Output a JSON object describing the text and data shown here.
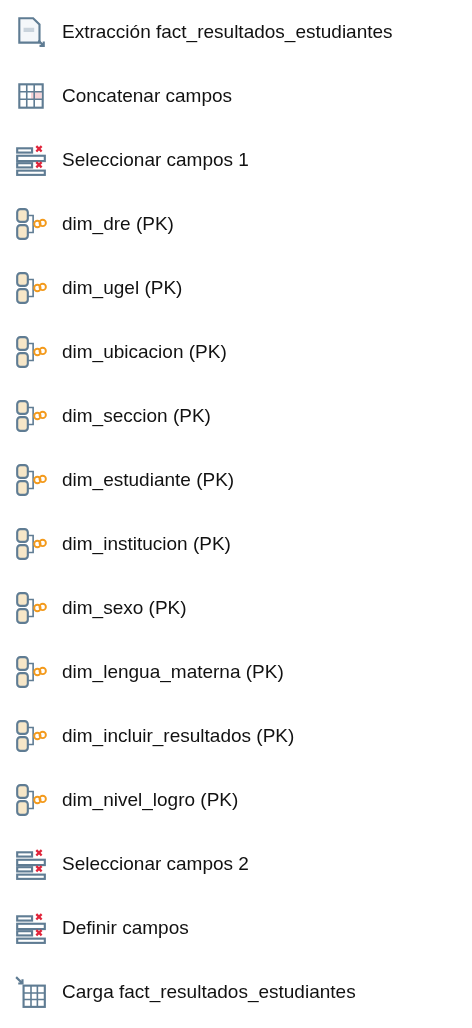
{
  "steps": [
    {
      "kind": "input",
      "label": "Extracción fact_resultados_estudiantes"
    },
    {
      "kind": "concat",
      "label": "Concatenar campos"
    },
    {
      "kind": "select",
      "label": "Seleccionar campos 1"
    },
    {
      "kind": "lookup",
      "label": "dim_dre (PK)"
    },
    {
      "kind": "lookup",
      "label": "dim_ugel (PK)"
    },
    {
      "kind": "lookup",
      "label": "dim_ubicacion (PK)"
    },
    {
      "kind": "lookup",
      "label": "dim_seccion (PK)"
    },
    {
      "kind": "lookup",
      "label": "dim_estudiante (PK)"
    },
    {
      "kind": "lookup",
      "label": "dim_institucion (PK)"
    },
    {
      "kind": "lookup",
      "label": "dim_sexo (PK)"
    },
    {
      "kind": "lookup",
      "label": "dim_lengua_materna (PK)"
    },
    {
      "kind": "lookup",
      "label": "dim_incluir_resultados (PK)"
    },
    {
      "kind": "lookup",
      "label": "dim_nivel_logro (PK)"
    },
    {
      "kind": "select",
      "label": "Seleccionar campos 2"
    },
    {
      "kind": "select",
      "label": "Definir campos"
    },
    {
      "kind": "output",
      "label": "Carga fact_resultados_estudiantes"
    }
  ]
}
